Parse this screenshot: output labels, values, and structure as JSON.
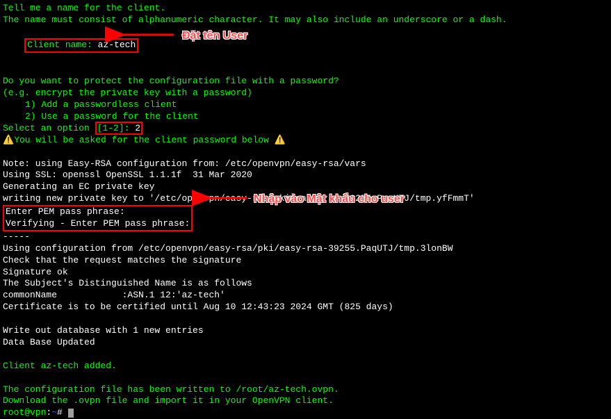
{
  "terminal": {
    "lines": {
      "tell": "Tell me a name for the client.",
      "must": "The name must consist of alphanumeric character. It may also include an underscore or a dash.",
      "client_name_label": "Client name: ",
      "client_name_value": "az-tech",
      "protect_q": "Do you want to protect the configuration file with a password?",
      "protect_eg": "(e.g. encrypt the private key with a password)",
      "opt1": "1) Add a passwordless client",
      "opt2": "2) Use a password for the client",
      "select_prefix": "Select an option ",
      "select_range": "[1-2]",
      "select_sep": ": ",
      "select_value": "2",
      "warn": "You will be asked for the client password below ",
      "note": "Note: using Easy-RSA configuration from: /etc/openvpn/easy-rsa/vars",
      "ssl": "Using SSL: openssl OpenSSL 1.1.1f  31 Mar 2020",
      "gen": "Generating an EC private key",
      "writing_key": "writing new private key to '/etc/openvpn/easy-rsa/pki/easy-rsa-39255.PaqUTJ/tmp.yfFmmT'",
      "enter_pem": "Enter PEM pass phrase:",
      "verify_pem": "Verifying - Enter PEM pass phrase:",
      "dashes": "-----",
      "using_cfg": "Using configuration from /etc/openvpn/easy-rsa/pki/easy-rsa-39255.PaqUTJ/tmp.3lonBW",
      "check_req": "Check that the request matches the signature",
      "sig_ok": "Signature ok",
      "subject_dn": "The Subject's Distinguished Name is as follows",
      "common_name": "commonName            :ASN.1 12:'az-tech'",
      "cert_until": "Certificate is to be certified until Aug 10 12:43:23 2024 GMT (825 days)",
      "write_db": "Write out database with 1 new entries",
      "db_updated": "Data Base Updated",
      "client_added": "Client az-tech added.",
      "cfg_written": "The configuration file has been written to /root/az-tech.ovpn.",
      "download": "Download the .ovpn file and import it in your OpenVPN client.",
      "prompt_user": "root@vpn",
      "prompt_sep": ":",
      "prompt_path": "~",
      "prompt_hash": "# "
    }
  },
  "annotations": {
    "label1": "Đặt tên User",
    "label2": "Nhập vào Mật khẩu cho user"
  },
  "icons": {
    "warning": "⚠️"
  }
}
